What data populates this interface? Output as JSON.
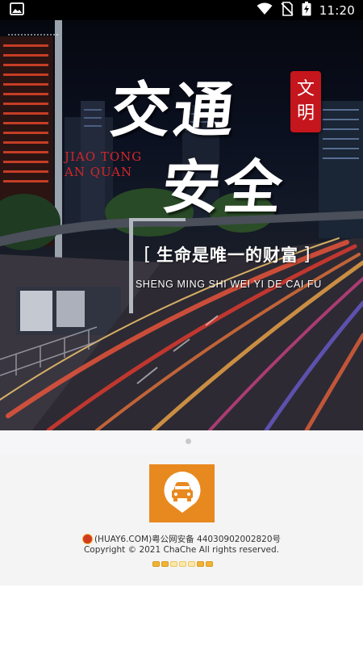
{
  "status_bar": {
    "time": "11:20",
    "icons": [
      "image-icon",
      "wifi-icon",
      "no-sim-icon",
      "battery-charging-icon"
    ]
  },
  "banner": {
    "title_line1": "交通",
    "title_line2": "安全",
    "seal_chars": [
      "文",
      "明"
    ],
    "pinyin_line1": "JIAO TONG",
    "pinyin_line2": "AN QUAN",
    "slogan": "生命是唯一的财富",
    "slogan_bracket_left": "[",
    "slogan_bracket_right": "]",
    "slogan_pinyin": "SHENG MING SHI WEI YI DE CAI FU"
  },
  "carousel": {
    "page_indicator_count": 1,
    "active_index": 0
  },
  "footer": {
    "app_logo_icon": "car-location-icon",
    "brand_color": "#e8891f",
    "icp_text": "(HUAY6.COM)粤公网安备 44030902002820号",
    "copyright": "Copyright © 2021 ChaChe All rights reserved.",
    "loading_indicator_count": 7
  }
}
